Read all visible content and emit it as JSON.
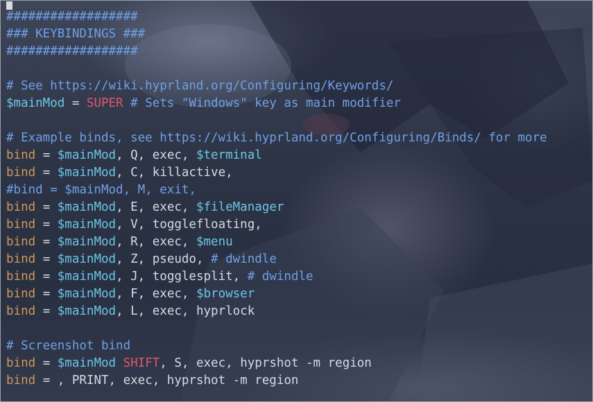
{
  "colors": {
    "comment": "#6fa0e8",
    "keyword": "#d0975a",
    "variable": "#6cc6e6",
    "modifier": "#e0566e",
    "text": "#d6dae3"
  },
  "editor": {
    "lines": [
      [
        {
          "t": "comment",
          "v": "##################"
        }
      ],
      [
        {
          "t": "comment",
          "v": "### KEYBINDINGS ###"
        }
      ],
      [
        {
          "t": "comment",
          "v": "##################"
        }
      ],
      [],
      [
        {
          "t": "comment",
          "v": "# See https://wiki.hyprland.org/Configuring/Keywords/"
        }
      ],
      [
        {
          "t": "var",
          "v": "$mainMod"
        },
        {
          "t": "plain",
          "v": " = "
        },
        {
          "t": "mod",
          "v": "SUPER"
        },
        {
          "t": "comment",
          "v": " # Sets \"Windows\" key as main modifier"
        }
      ],
      [],
      [
        {
          "t": "comment",
          "v": "# Example binds, see https://wiki.hyprland.org/Configuring/Binds/ for more"
        }
      ],
      [
        {
          "t": "kw",
          "v": "bind"
        },
        {
          "t": "plain",
          "v": " = "
        },
        {
          "t": "var",
          "v": "$mainMod"
        },
        {
          "t": "plain",
          "v": ", Q, exec, "
        },
        {
          "t": "var",
          "v": "$terminal"
        }
      ],
      [
        {
          "t": "kw",
          "v": "bind"
        },
        {
          "t": "plain",
          "v": " = "
        },
        {
          "t": "var",
          "v": "$mainMod"
        },
        {
          "t": "plain",
          "v": ", C, killactive,"
        }
      ],
      [
        {
          "t": "comment",
          "v": "#bind = $mainMod, M, exit,"
        }
      ],
      [
        {
          "t": "kw",
          "v": "bind"
        },
        {
          "t": "plain",
          "v": " = "
        },
        {
          "t": "var",
          "v": "$mainMod"
        },
        {
          "t": "plain",
          "v": ", E, exec, "
        },
        {
          "t": "var",
          "v": "$fileManager"
        }
      ],
      [
        {
          "t": "kw",
          "v": "bind"
        },
        {
          "t": "plain",
          "v": " = "
        },
        {
          "t": "var",
          "v": "$mainMod"
        },
        {
          "t": "plain",
          "v": ", V, togglefloating,"
        }
      ],
      [
        {
          "t": "kw",
          "v": "bind"
        },
        {
          "t": "plain",
          "v": " = "
        },
        {
          "t": "var",
          "v": "$mainMod"
        },
        {
          "t": "plain",
          "v": ", R, exec, "
        },
        {
          "t": "var",
          "v": "$menu"
        }
      ],
      [
        {
          "t": "kw",
          "v": "bind"
        },
        {
          "t": "plain",
          "v": " = "
        },
        {
          "t": "var",
          "v": "$mainMod"
        },
        {
          "t": "plain",
          "v": ", Z, pseudo, "
        },
        {
          "t": "comment",
          "v": "# dwindle"
        }
      ],
      [
        {
          "t": "kw",
          "v": "bind"
        },
        {
          "t": "plain",
          "v": " = "
        },
        {
          "t": "var",
          "v": "$mainMod"
        },
        {
          "t": "plain",
          "v": ", J, togglesplit, "
        },
        {
          "t": "comment",
          "v": "# dwindle"
        }
      ],
      [
        {
          "t": "kw",
          "v": "bind"
        },
        {
          "t": "plain",
          "v": " = "
        },
        {
          "t": "var",
          "v": "$mainMod"
        },
        {
          "t": "plain",
          "v": ", F, exec, "
        },
        {
          "t": "var",
          "v": "$browser"
        }
      ],
      [
        {
          "t": "kw",
          "v": "bind"
        },
        {
          "t": "plain",
          "v": " = "
        },
        {
          "t": "var",
          "v": "$mainMod"
        },
        {
          "t": "plain",
          "v": ", L, exec, hyprlock"
        }
      ],
      [],
      [
        {
          "t": "comment",
          "v": "# Screenshot bind"
        }
      ],
      [
        {
          "t": "kw",
          "v": "bind"
        },
        {
          "t": "plain",
          "v": " = "
        },
        {
          "t": "var",
          "v": "$mainMod"
        },
        {
          "t": "plain",
          "v": " "
        },
        {
          "t": "mod",
          "v": "SHIFT"
        },
        {
          "t": "plain",
          "v": ", S, exec, hyprshot -m region"
        }
      ],
      [
        {
          "t": "kw",
          "v": "bind"
        },
        {
          "t": "plain",
          "v": " = , PRINT, exec, hyprshot -m region"
        }
      ]
    ]
  }
}
